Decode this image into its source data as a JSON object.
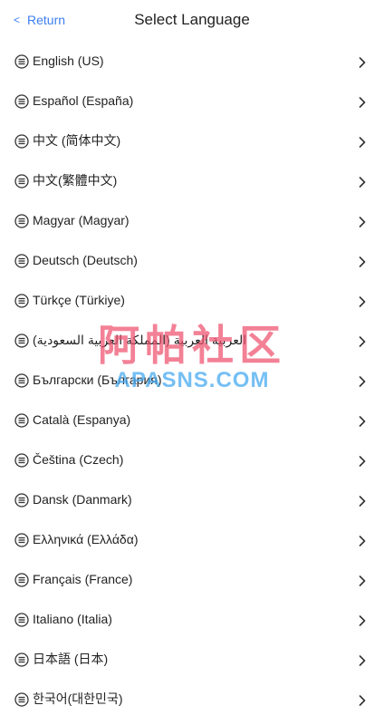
{
  "header": {
    "back_chevron": "<",
    "back_label": "Return",
    "title": "Select Language"
  },
  "icons": {
    "row_icon": "menu-lines-icon",
    "chevron": "chevron-right-icon"
  },
  "languages": [
    {
      "label": "English (US)"
    },
    {
      "label": "Español (España)"
    },
    {
      "label": "中文 (简体中文)"
    },
    {
      "label": "中文(繁體中文)"
    },
    {
      "label": "Magyar (Magyar)"
    },
    {
      "label": "Deutsch (Deutsch)"
    },
    {
      "label": "Türkçe (Türkiye)"
    },
    {
      "label": "العربية العربية (المملكة العربية السعودية)"
    },
    {
      "label": "Български (България)"
    },
    {
      "label": "Català (Espanya)"
    },
    {
      "label": "Čeština (Czech)"
    },
    {
      "label": "Dansk (Danmark)"
    },
    {
      "label": "Ελληνικά (Ελλάδα)"
    },
    {
      "label": "Français (France)"
    },
    {
      "label": "Italiano (Italia)"
    },
    {
      "label": "日本語 (日本)"
    },
    {
      "label": "한국어(대한민국)"
    }
  ],
  "watermark": {
    "cn": "阿帕社区",
    "en": "APASNS.COM"
  }
}
